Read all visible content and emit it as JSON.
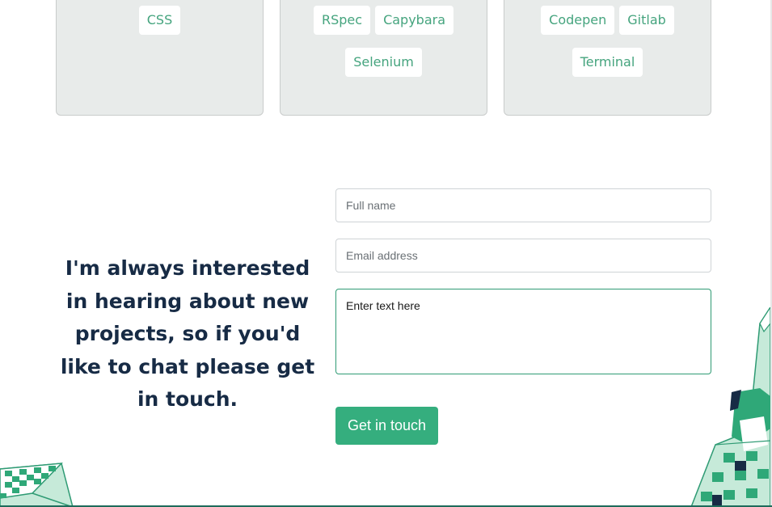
{
  "skills": {
    "cards": [
      {
        "tags": [
          "CSS"
        ]
      },
      {
        "tags": [
          "RSpec",
          "Capybara",
          "Selenium"
        ]
      },
      {
        "tags": [
          "Codepen",
          "Gitlab",
          "Terminal"
        ]
      }
    ]
  },
  "contact": {
    "pitch": "I'm always interested in hearing about new projects, so if you'd like to chat please get in touch.",
    "name_placeholder": "Full name",
    "email_placeholder": "Email address",
    "message_placeholder": "Enter text here",
    "submit_label": "Get in touch"
  },
  "colors": {
    "accent": "#35ae7e",
    "tag_text": "#45a47e",
    "heading": "#172b45",
    "card_bg": "#e8ebea"
  }
}
